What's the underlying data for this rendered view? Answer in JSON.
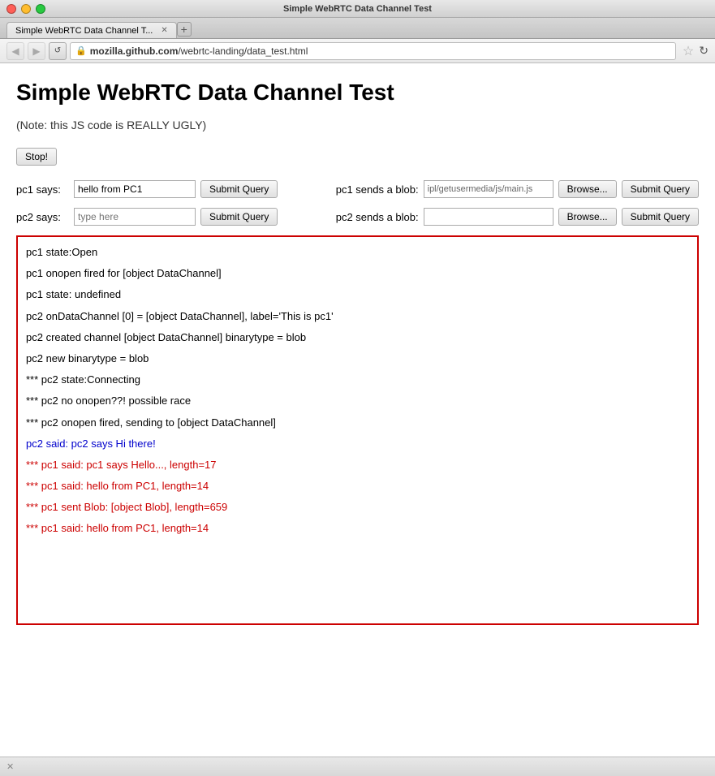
{
  "window": {
    "title": "Simple WebRTC Data Channel Test"
  },
  "titlebar": {
    "text": "Simple WebRTC Data Channel T..."
  },
  "navbar": {
    "url": "mozilla.github.com/webrtc-landing/data_test.html",
    "url_bold_part": "mozilla.github.com",
    "url_rest": "/webrtc-landing/data_test.html"
  },
  "page": {
    "title": "Simple WebRTC Data Channel Test",
    "subtitle": "(Note: this JS code is REALLY UGLY)",
    "stop_button": "Stop!",
    "pc1_label": "pc1 says:",
    "pc1_value": "hello from PC1",
    "pc1_submit": "Submit Query",
    "pc1_blob_label": "pc1 sends a blob:",
    "pc1_blob_value": "ipl/getusermedia/js/main.js",
    "pc1_browse": "Browse...",
    "pc1_blob_submit": "Submit Query",
    "pc2_label": "pc2 says:",
    "pc2_value": "type here",
    "pc2_submit": "Submit Query",
    "pc2_blob_label": "pc2 sends a blob:",
    "pc2_blob_value": "",
    "pc2_browse": "Browse...",
    "pc2_blob_submit": "Submit Query"
  },
  "log": {
    "lines": [
      {
        "text": "pc1 state:Open",
        "color": "black"
      },
      {
        "text": "pc1 onopen fired for [object DataChannel]",
        "color": "black"
      },
      {
        "text": "pc1 state: undefined",
        "color": "black"
      },
      {
        "text": "pc2 onDataChannel [0] = [object DataChannel], label='This is pc1'",
        "color": "black"
      },
      {
        "text": "pc2 created channel [object DataChannel] binarytype = blob",
        "color": "black"
      },
      {
        "text": "pc2 new binarytype = blob",
        "color": "black"
      },
      {
        "text": "*** pc2 state:Connecting",
        "color": "black"
      },
      {
        "text": "*** pc2 no onopen??! possible race",
        "color": "black"
      },
      {
        "text": "*** pc2 onopen fired, sending to [object DataChannel]",
        "color": "black"
      },
      {
        "text": "pc2 said: pc2 says Hi there!",
        "color": "blue"
      },
      {
        "text": "*** pc1 said: pc1 says Hello..., length=17",
        "color": "red"
      },
      {
        "text": "*** pc1 said: hello from PC1, length=14",
        "color": "red"
      },
      {
        "text": "*** pc1 sent Blob: [object Blob], length=659",
        "color": "red"
      },
      {
        "text": "*** pc1 said: hello from PC1, length=14",
        "color": "red"
      }
    ]
  },
  "statusbar": {
    "text": "✕"
  }
}
